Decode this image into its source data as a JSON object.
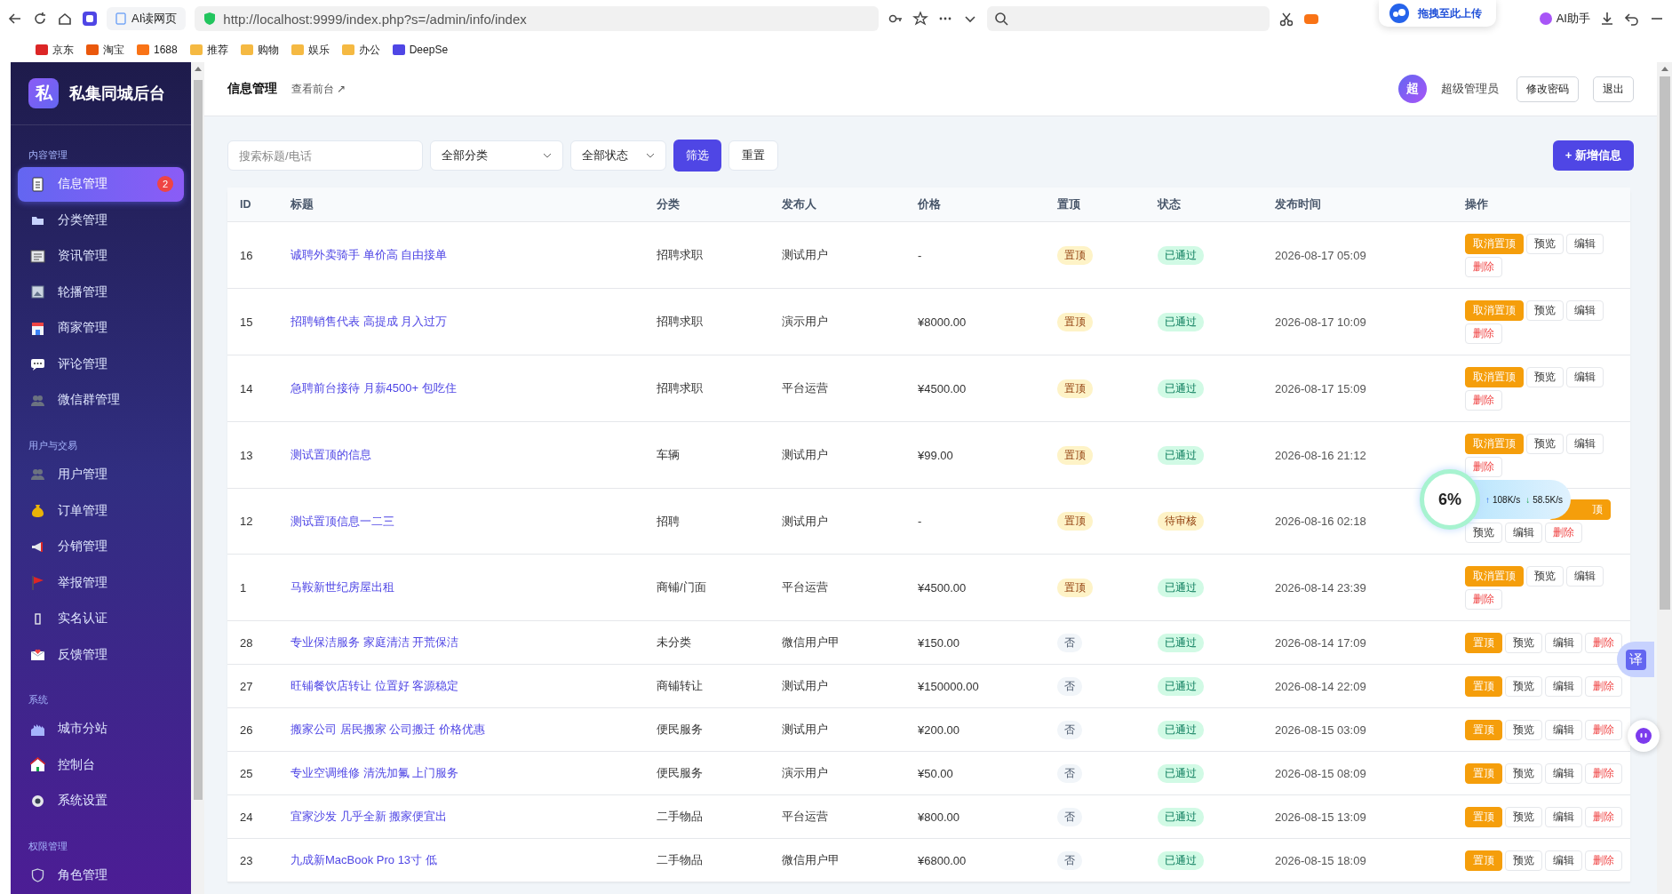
{
  "browser": {
    "tab_title": "AI读网页",
    "url": "http://localhost:9999/index.php?s=/admin/info/index",
    "ai_assistant": "AI助手",
    "upload_hint": "拖拽至此上传",
    "bookmarks": [
      "京东",
      "淘宝",
      "1688",
      "推荐",
      "购物",
      "娱乐",
      "办公",
      "DeepSe"
    ]
  },
  "sidebar": {
    "logo": "私",
    "title": "私集同城后台",
    "sections": [
      {
        "title": "内容管理",
        "items": [
          {
            "label": "信息管理",
            "selected": true,
            "badge": "2"
          },
          {
            "label": "分类管理",
            "selected": false
          },
          {
            "label": "资讯管理",
            "selected": false
          },
          {
            "label": "轮播管理",
            "selected": false
          },
          {
            "label": "商家管理",
            "selected": false
          },
          {
            "label": "评论管理",
            "selected": false
          },
          {
            "label": "微信群管理",
            "selected": false
          }
        ]
      },
      {
        "title": "用户与交易",
        "items": [
          {
            "label": "用户管理",
            "selected": false
          },
          {
            "label": "订单管理",
            "selected": false
          },
          {
            "label": "分销管理",
            "selected": false
          },
          {
            "label": "举报管理",
            "selected": false
          },
          {
            "label": "实名认证",
            "selected": false
          },
          {
            "label": "反馈管理",
            "selected": false
          }
        ]
      },
      {
        "title": "系统",
        "items": [
          {
            "label": "城市分站",
            "selected": false
          },
          {
            "label": "控制台",
            "selected": false
          },
          {
            "label": "系统设置",
            "selected": false
          }
        ]
      },
      {
        "title": "权限管理",
        "items": [
          {
            "label": "角色管理",
            "selected": false
          }
        ]
      }
    ]
  },
  "header": {
    "title": "信息管理",
    "link": "查看前台",
    "link_arrow": "↗",
    "avatar": "超",
    "user": "超级管理员",
    "buttons": [
      "修改密码",
      "退出"
    ]
  },
  "filters": {
    "search_placeholder": "搜索标题/电话",
    "selects": [
      "全部分类",
      "全部状态"
    ],
    "filter_button": "筛选",
    "reset_button": "重置",
    "add_button": "+ 新增信息"
  },
  "table": {
    "columns": [
      "ID",
      "标题",
      "分类",
      "发布人",
      "价格",
      "置顶",
      "状态",
      "发布时间",
      "操作"
    ],
    "rows": [
      {
        "id": "16",
        "title": "诚聘外卖骑手 单价高 自由接单",
        "category": "招聘求职",
        "publisher": "测试用户",
        "price": "-",
        "pinned": true,
        "pin_label": "置顶",
        "status": {
          "label": "已通过",
          "kind": "approved"
        },
        "time": "2026-08-17 05:09",
        "actions": [
          {
            "label": "取消置顶",
            "kind": "warn"
          },
          {
            "label": "预览",
            "kind": "plain"
          },
          {
            "label": "编辑",
            "kind": "plain"
          },
          {
            "label": "删除",
            "kind": "danger"
          }
        ]
      },
      {
        "id": "15",
        "title": "招聘销售代表 高提成 月入过万",
        "category": "招聘求职",
        "publisher": "演示用户",
        "price": "¥8000.00",
        "pinned": true,
        "pin_label": "置顶",
        "status": {
          "label": "已通过",
          "kind": "approved"
        },
        "time": "2026-08-17 10:09",
        "actions": [
          {
            "label": "取消置顶",
            "kind": "warn"
          },
          {
            "label": "预览",
            "kind": "plain"
          },
          {
            "label": "编辑",
            "kind": "plain"
          },
          {
            "label": "删除",
            "kind": "danger"
          }
        ]
      },
      {
        "id": "14",
        "title": "急聘前台接待 月薪4500+ 包吃住",
        "category": "招聘求职",
        "publisher": "平台运营",
        "price": "¥4500.00",
        "pinned": true,
        "pin_label": "置顶",
        "status": {
          "label": "已通过",
          "kind": "approved"
        },
        "time": "2026-08-17 15:09",
        "actions": [
          {
            "label": "取消置顶",
            "kind": "warn"
          },
          {
            "label": "预览",
            "kind": "plain"
          },
          {
            "label": "编辑",
            "kind": "plain"
          },
          {
            "label": "删除",
            "kind": "danger"
          }
        ]
      },
      {
        "id": "13",
        "title": "测试置顶的信息",
        "category": "车辆",
        "publisher": "测试用户",
        "price": "¥99.00",
        "pinned": true,
        "pin_label": "置顶",
        "status": {
          "label": "已通过",
          "kind": "approved"
        },
        "time": "2026-08-16 21:12",
        "actions": [
          {
            "label": "取消置顶",
            "kind": "warn"
          },
          {
            "label": "预览",
            "kind": "plain"
          },
          {
            "label": "编辑",
            "kind": "plain"
          },
          {
            "label": "删除",
            "kind": "danger"
          }
        ]
      },
      {
        "id": "12",
        "title": "测试置顶信息一二三",
        "category": "招聘",
        "publisher": "测试用户",
        "price": "-",
        "pinned": true,
        "pin_label": "置顶",
        "status": {
          "label": "待审核",
          "kind": "pending"
        },
        "time": "2026-08-16 02:18",
        "actions": [
          {
            "label": "顶",
            "kind": "covered"
          },
          {
            "label": "预览",
            "kind": "plain"
          },
          {
            "label": "编辑",
            "kind": "plain"
          },
          {
            "label": "删除",
            "kind": "danger"
          }
        ]
      },
      {
        "id": "1",
        "title": "马鞍新世纪房屋出租",
        "category": "商铺/门面",
        "publisher": "平台运营",
        "price": "¥4500.00",
        "pinned": true,
        "pin_label": "置顶",
        "status": {
          "label": "已通过",
          "kind": "approved"
        },
        "time": "2026-08-14 23:39",
        "actions": [
          {
            "label": "取消置顶",
            "kind": "warn"
          },
          {
            "label": "预览",
            "kind": "plain"
          },
          {
            "label": "编辑",
            "kind": "plain"
          },
          {
            "label": "删除",
            "kind": "danger"
          }
        ]
      },
      {
        "id": "28",
        "title": "专业保洁服务 家庭清洁 开荒保洁",
        "category": "未分类",
        "publisher": "微信用户甲",
        "price": "¥150.00",
        "pinned": false,
        "pin_label": "否",
        "status": {
          "label": "已通过",
          "kind": "approved"
        },
        "time": "2026-08-14 17:09",
        "actions": [
          {
            "label": "置顶",
            "kind": "warn"
          },
          {
            "label": "预览",
            "kind": "plain"
          },
          {
            "label": "编辑",
            "kind": "plain"
          },
          {
            "label": "删除",
            "kind": "danger"
          }
        ]
      },
      {
        "id": "27",
        "title": "旺铺餐饮店转让 位置好 客源稳定",
        "category": "商铺转让",
        "publisher": "测试用户",
        "price": "¥150000.00",
        "pinned": false,
        "pin_label": "否",
        "status": {
          "label": "已通过",
          "kind": "approved"
        },
        "time": "2026-08-14 22:09",
        "actions": [
          {
            "label": "置顶",
            "kind": "warn"
          },
          {
            "label": "预览",
            "kind": "plain"
          },
          {
            "label": "编辑",
            "kind": "plain"
          },
          {
            "label": "删除",
            "kind": "danger"
          }
        ]
      },
      {
        "id": "26",
        "title": "搬家公司 居民搬家 公司搬迁 价格优惠",
        "category": "便民服务",
        "publisher": "测试用户",
        "price": "¥200.00",
        "pinned": false,
        "pin_label": "否",
        "status": {
          "label": "已通过",
          "kind": "approved"
        },
        "time": "2026-08-15 03:09",
        "actions": [
          {
            "label": "置顶",
            "kind": "warn"
          },
          {
            "label": "预览",
            "kind": "plain"
          },
          {
            "label": "编辑",
            "kind": "plain"
          },
          {
            "label": "删除",
            "kind": "danger"
          }
        ]
      },
      {
        "id": "25",
        "title": "专业空调维修 清洗加氟 上门服务",
        "category": "便民服务",
        "publisher": "演示用户",
        "price": "¥50.00",
        "pinned": false,
        "pin_label": "否",
        "status": {
          "label": "已通过",
          "kind": "approved"
        },
        "time": "2026-08-15 08:09",
        "actions": [
          {
            "label": "置顶",
            "kind": "warn"
          },
          {
            "label": "预览",
            "kind": "plain"
          },
          {
            "label": "编辑",
            "kind": "plain"
          },
          {
            "label": "删除",
            "kind": "danger"
          }
        ]
      },
      {
        "id": "24",
        "title": "宜家沙发 几乎全新 搬家便宜出",
        "category": "二手物品",
        "publisher": "平台运营",
        "price": "¥800.00",
        "pinned": false,
        "pin_label": "否",
        "status": {
          "label": "已通过",
          "kind": "approved"
        },
        "time": "2026-08-15 13:09",
        "actions": [
          {
            "label": "置顶",
            "kind": "warn"
          },
          {
            "label": "预览",
            "kind": "plain"
          },
          {
            "label": "编辑",
            "kind": "plain"
          },
          {
            "label": "删除",
            "kind": "danger"
          }
        ]
      },
      {
        "id": "23",
        "title": "九成新MacBook Pro 13寸 低",
        "category": "二手物品",
        "publisher": "微信用户甲",
        "price": "¥6800.00",
        "pinned": false,
        "pin_label": "否",
        "status": {
          "label": "已通过",
          "kind": "approved"
        },
        "time": "2026-08-15 18:09",
        "actions": [
          {
            "label": "置顶",
            "kind": "warn"
          },
          {
            "label": "预览",
            "kind": "plain"
          },
          {
            "label": "编辑",
            "kind": "plain"
          },
          {
            "label": "删除",
            "kind": "danger"
          }
        ]
      }
    ]
  },
  "speed_widget": {
    "usage": "6%",
    "upload_arrow": "↑",
    "upload": "108K/s",
    "download_arrow": "↓",
    "download": "58.5K/s"
  },
  "translate_button": "译"
}
